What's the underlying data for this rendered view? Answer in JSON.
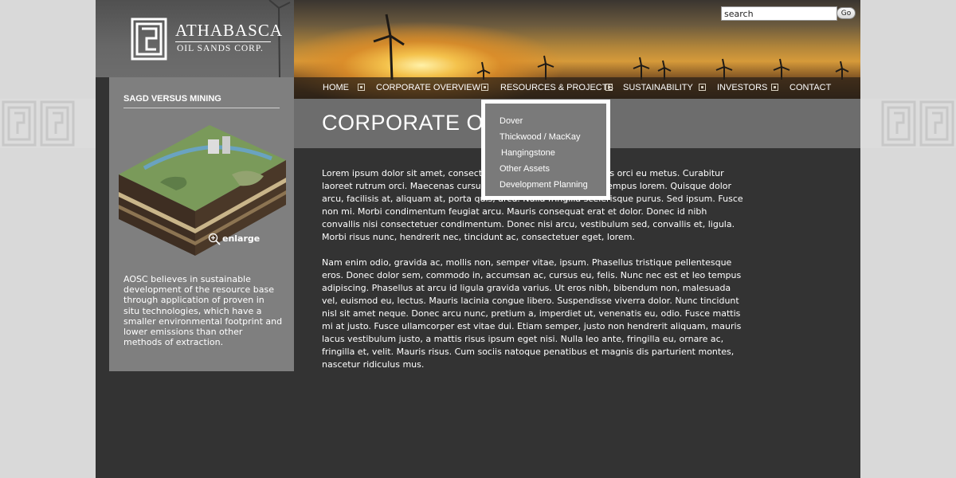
{
  "header": {
    "logo_name": "ATHABASCA",
    "logo_sub": "OIL SANDS CORP."
  },
  "search": {
    "value": "search",
    "button_label": "Go"
  },
  "nav": {
    "items": [
      {
        "label": "HOME"
      },
      {
        "label": "CORPORATE OVERVIEW"
      },
      {
        "label": "RESOURCES & PROJECTS"
      },
      {
        "label": "SUSTAINABILITY"
      },
      {
        "label": "INVESTORS"
      },
      {
        "label": "CONTACT"
      }
    ]
  },
  "dropdown": {
    "items": [
      {
        "label": "Dover"
      },
      {
        "label": "Thickwood / MacKay"
      },
      {
        "label": "Hangingstone"
      },
      {
        "label": "Other Assets"
      },
      {
        "label": "Development Planning"
      }
    ]
  },
  "sidebar": {
    "title": "SAGD VERSUS MINING",
    "enlarge_label": "enlarge",
    "text": "AOSC believes in sustainable development of the resource base through application of proven in situ technologies, which have a smaller environmental footprint and lower emissions than other methods of extraction."
  },
  "main": {
    "title": "CORPORATE OVERVIEW",
    "paragraphs": [
      "Lorem ipsum dolor sit amet, consectetur adipiscing elit. Sed mollis orci eu metus. Curabitur laoreet rutrum orci. Maecenas cursus mauris at lorem. Vivamus tempus lorem. Quisque dolor arcu, facilisis at, aliquam at, porta quis, arcu. Nulla fringilla scelerisque purus. Sed ipsum. Fusce non mi. Morbi condimentum feugiat arcu. Mauris consequat erat et dolor. Donec id nibh convallis nisi consectetuer condimentum. Donec nisi arcu, vestibulum sed, convallis et, ligula. Morbi risus nunc, hendrerit nec, tincidunt ac, consectetuer eget, lorem.",
      "Nam enim odio, gravida ac, mollis non, semper vitae, ipsum. Phasellus tristique pellentesque eros. Donec dolor sem, commodo in, accumsan ac, cursus eu, felis. Nunc nec est et leo tempus adipiscing. Phasellus at arcu id ligula gravida varius. Ut eros nibh, bibendum non, malesuada vel, euismod eu, lectus. Mauris lacinia congue libero. Suspendisse viverra dolor. Nunc tincidunt nisl sit amet neque. Donec arcu nunc, pretium a, imperdiet ut, venenatis eu, odio. Fusce mattis mi at justo. Fusce ullamcorper est vitae dui. Etiam semper, justo non hendrerit aliquam, mauris lacus vestibulum justo, a mattis risus ipsum eget nisi. Nulla leo ante, fringilla eu, ornare ac, fringilla et, velit. Mauris risus. Cum sociis natoque penatibus et magnis dis parturient montes, nascetur ridiculus mus."
    ]
  },
  "colors": {
    "page_bg": "#333333",
    "outer_bg": "#d9d9d9",
    "sidebar_bg": "#7f7f7f",
    "title_band": "#6d6d6d",
    "dropdown_bg": "#7a7a7a"
  }
}
